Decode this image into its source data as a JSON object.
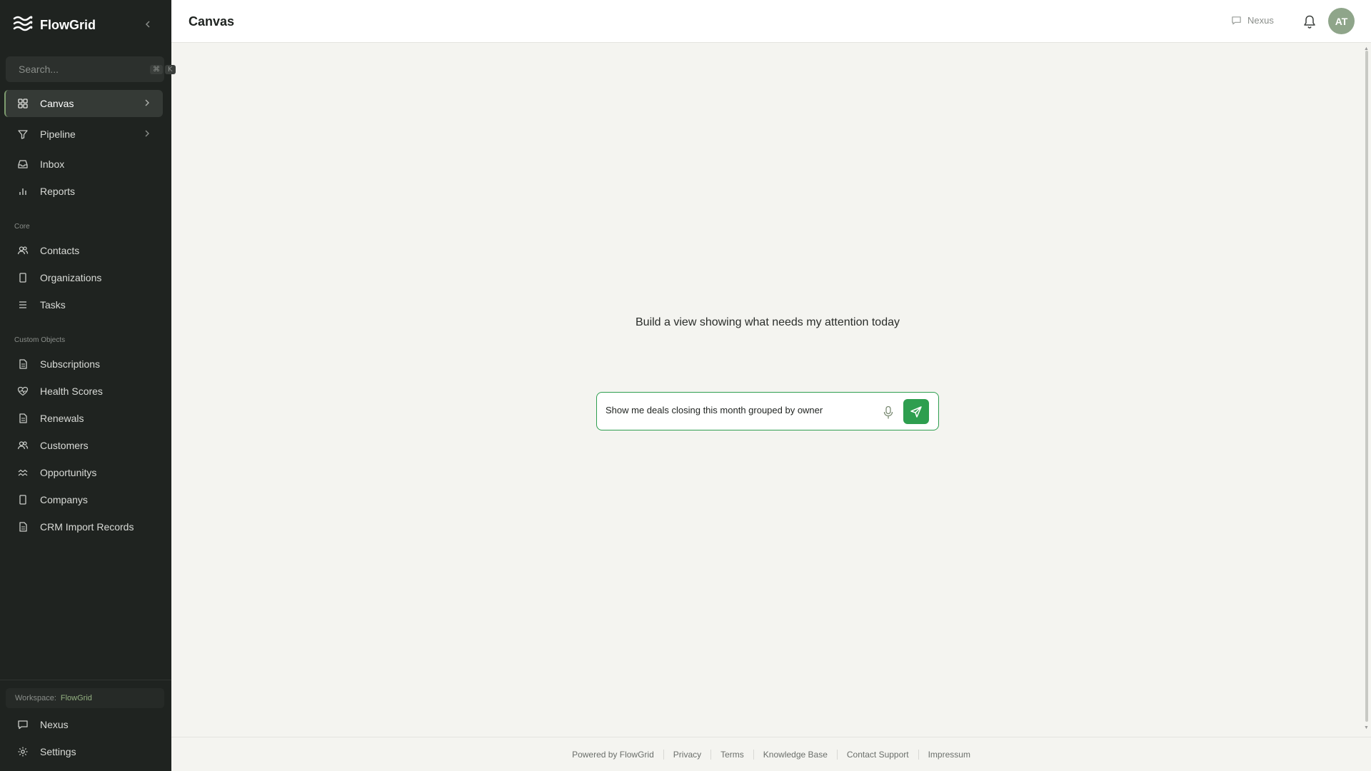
{
  "app": {
    "name": "FlowGrid"
  },
  "search": {
    "placeholder": "Search...",
    "shortcut_mod": "⌘",
    "shortcut_key": "K"
  },
  "nav": {
    "primary": [
      {
        "label": "Canvas",
        "icon": "grid-icon",
        "active": true,
        "has_chevron": true
      },
      {
        "label": "Pipeline",
        "icon": "filter-icon",
        "has_chevron": true
      },
      {
        "label": "Inbox",
        "icon": "inbox-icon"
      },
      {
        "label": "Reports",
        "icon": "bar-chart-icon"
      }
    ],
    "core_label": "Core",
    "core": [
      {
        "label": "Contacts",
        "icon": "users-icon"
      },
      {
        "label": "Organizations",
        "icon": "building-icon"
      },
      {
        "label": "Tasks",
        "icon": "list-icon"
      }
    ],
    "custom_label": "Custom Objects",
    "custom": [
      {
        "label": "Subscriptions",
        "icon": "document-icon"
      },
      {
        "label": "Health Scores",
        "icon": "heart-pulse-icon"
      },
      {
        "label": "Renewals",
        "icon": "document-icon"
      },
      {
        "label": "Customers",
        "icon": "users-icon"
      },
      {
        "label": "Opportunitys",
        "icon": "trend-icon"
      },
      {
        "label": "Companys",
        "icon": "building-icon"
      },
      {
        "label": "CRM Import Records",
        "icon": "document-icon"
      }
    ]
  },
  "workspace": {
    "prefix": "Workspace:",
    "name": "FlowGrid"
  },
  "bottom_nav": [
    {
      "label": "Nexus",
      "icon": "chat-icon"
    },
    {
      "label": "Settings",
      "icon": "gear-icon"
    }
  ],
  "header": {
    "title": "Canvas",
    "nexus_label": "Nexus",
    "avatar_initials": "AT"
  },
  "main": {
    "prompt_title": "Build a view showing what needs my attention today",
    "composer_value": "Show me deals closing this month grouped by owner"
  },
  "footer": {
    "powered_by": "Powered by FlowGrid",
    "links": [
      "Privacy",
      "Terms",
      "Knowledge Base",
      "Contact Support",
      "Impressum"
    ]
  },
  "colors": {
    "sidebar_bg": "#1f2320",
    "accent_green": "#2e9e4f",
    "avatar_bg": "#8fa58a",
    "page_bg": "#f4f4f0"
  }
}
